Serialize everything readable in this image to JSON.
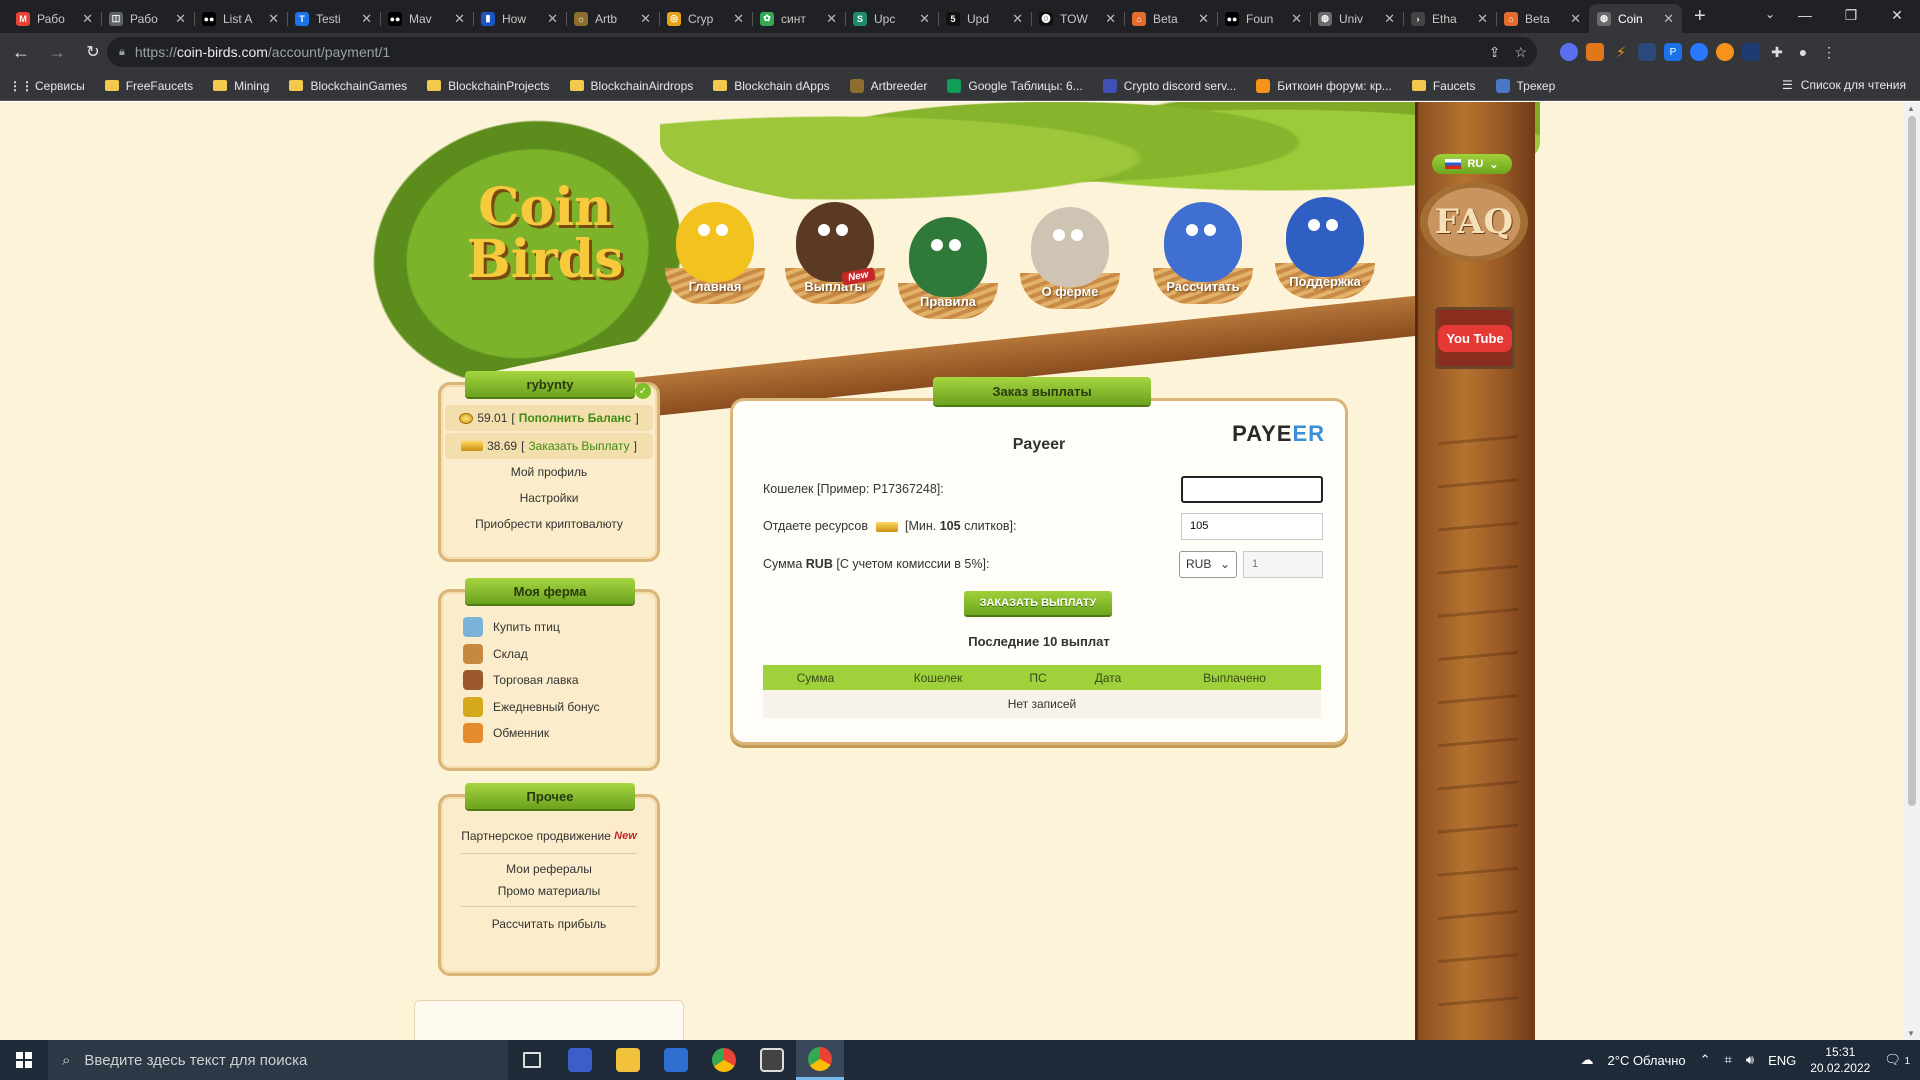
{
  "browser": {
    "tabs": [
      {
        "title": "Рабо",
        "color": "#ea4335",
        "glyph": "M"
      },
      {
        "title": "Рабо",
        "color": "#5f6368",
        "glyph": "◫"
      },
      {
        "title": "List A",
        "color": "#000000",
        "glyph": "●●"
      },
      {
        "title": "Testi",
        "color": "#1a73e8",
        "glyph": "T"
      },
      {
        "title": "Mav",
        "color": "#000000",
        "glyph": "●●"
      },
      {
        "title": "How",
        "color": "#1a56c4",
        "glyph": "▮"
      },
      {
        "title": "Artb",
        "color": "#8d6e2f",
        "glyph": "☼"
      },
      {
        "title": "Cryp",
        "color": "#e8a317",
        "glyph": "◎"
      },
      {
        "title": "синт",
        "color": "#34a853",
        "glyph": "✿"
      },
      {
        "title": "Upc",
        "color": "#1f8a70",
        "glyph": "S"
      },
      {
        "title": "Upd",
        "color": "#111111",
        "glyph": "5"
      },
      {
        "title": "TOW",
        "color": "#111111",
        "glyph": "⓿"
      },
      {
        "title": "Beta",
        "color": "#e36b2c",
        "glyph": "⌂"
      },
      {
        "title": "Foun",
        "color": "#000000",
        "glyph": "●●"
      },
      {
        "title": "Univ",
        "color": "#6b6b6b",
        "glyph": "◍"
      },
      {
        "title": "Etha",
        "color": "#444444",
        "glyph": "›"
      },
      {
        "title": "Beta",
        "color": "#e36b2c",
        "glyph": "⌂"
      },
      {
        "title": "Coin",
        "color": "#6b6b6b",
        "glyph": "◍",
        "active": true
      }
    ],
    "new_tab": "+",
    "url_host": "coin-birds.com",
    "url_prefix": "https://",
    "url_path": "/account/payment/1",
    "bookmarks": [
      {
        "label": "Сервисы",
        "kind": "apps"
      },
      {
        "label": "FreeFaucets",
        "kind": "folder"
      },
      {
        "label": "Mining",
        "kind": "folder"
      },
      {
        "label": "BlockchainGames",
        "kind": "folder"
      },
      {
        "label": "BlockchainProjects",
        "kind": "folder"
      },
      {
        "label": "BlockchainAirdrops",
        "kind": "folder"
      },
      {
        "label": "Blockchain dApps",
        "kind": "folder"
      },
      {
        "label": "Artbreeder",
        "kind": "icon",
        "color": "#8d6e2f"
      },
      {
        "label": "Google Таблицы: 6...",
        "kind": "icon",
        "color": "#0f9d58"
      },
      {
        "label": "Crypto discord serv...",
        "kind": "icon",
        "color": "#3f51b5"
      },
      {
        "label": "Биткоин форум: кр...",
        "kind": "icon",
        "color": "#f7931a"
      },
      {
        "label": "Faucets",
        "kind": "folder"
      },
      {
        "label": "Трекер",
        "kind": "icon",
        "color": "#4a76c8"
      }
    ],
    "reading_list": "Список для чтения"
  },
  "site": {
    "logo_line1": "Coin",
    "logo_line2": "Birds",
    "lang": "RU",
    "faq": "FAQ",
    "youtube": "You Tube",
    "nav": [
      {
        "label": "Главная",
        "color": "#f2c21f"
      },
      {
        "label": "Выплаты",
        "color": "#5a3a22",
        "badge": "New"
      },
      {
        "label": "Правила",
        "color": "#2f7a3a"
      },
      {
        "label": "О ферме",
        "color": "#cfc4b3"
      },
      {
        "label": "Рассчитать",
        "color": "#3e6fd1"
      },
      {
        "label": "Поддержка",
        "color": "#2f5fc2"
      }
    ]
  },
  "user_panel": {
    "username": "rybynty",
    "balance": "59.01",
    "topup": "Пополнить Баланс",
    "resources": "38.69",
    "withdraw": "Заказать Выплату",
    "links": [
      "Мой профиль",
      "Настройки",
      "Приобрести криптовалюту"
    ]
  },
  "farm_panel": {
    "title": "Моя ферма",
    "items": [
      {
        "label": "Купить птиц",
        "color": "#7bb2d9"
      },
      {
        "label": "Склад",
        "color": "#c58a3e"
      },
      {
        "label": "Торговая лавка",
        "color": "#9c5a2c"
      },
      {
        "label": "Ежедневный бонус",
        "color": "#d6a91d"
      },
      {
        "label": "Обменник",
        "color": "#e68a2e"
      }
    ]
  },
  "other_panel": {
    "title": "Прочее",
    "partner": "Партнерское продвижение",
    "partner_badge": "New",
    "referrals": "Мои рефералы",
    "promo": "Промо материалы",
    "calc": "Рассчитать прибыль"
  },
  "payout": {
    "ribbon": "Заказ выплаты",
    "method": "Payeer",
    "logo_main": "PAYE",
    "logo_accent": "ER",
    "wallet_label": "Кошелек [Пример: P17367248]:",
    "wallet_value": "",
    "resources_prefix": "Отдаете ресурсов",
    "resources_middle": "[Мин.",
    "resources_min": "105",
    "resources_suffix": "слитков]:",
    "resources_value": "105",
    "sum_prefix": "Сумма",
    "sum_currency": "RUB",
    "sum_suffix": "[С учетом комиссии в 5%]:",
    "currency_selected": "RUB",
    "sum_value": "1",
    "order_button": "ЗАКАЗАТЬ ВЫПЛАТУ",
    "last_title": "Последние 10 выплат",
    "columns": [
      "Сумма",
      "Кошелек",
      "ПС",
      "Дата",
      "Выплачено"
    ],
    "empty": "Нет записей"
  },
  "taskbar": {
    "search_placeholder": "Введите здесь текст для поиска",
    "weather": "2°C Облачно",
    "lang": "ENG",
    "time": "15:31",
    "date": "20.02.2022",
    "notifications": "1"
  }
}
